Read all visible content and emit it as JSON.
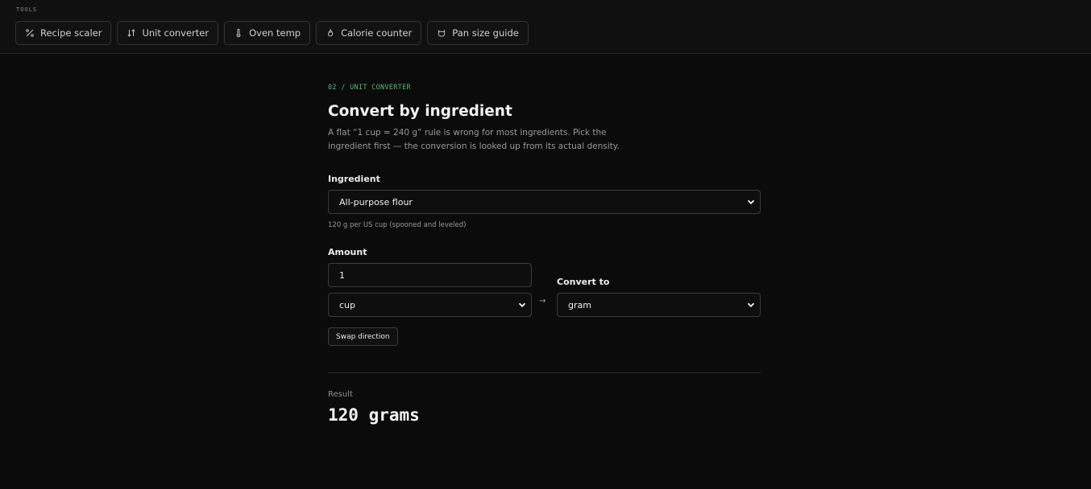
{
  "tools": {
    "label": "TOOLS",
    "items": [
      {
        "label": "Recipe scaler",
        "icon": "percent-icon"
      },
      {
        "label": "Unit converter",
        "icon": "swap-arrows-icon"
      },
      {
        "label": "Oven temp",
        "icon": "thermometer-icon"
      },
      {
        "label": "Calorie counter",
        "icon": "flame-icon"
      },
      {
        "label": "Pan size guide",
        "icon": "pan-icon"
      }
    ]
  },
  "page": {
    "crumb": "02 / UNIT CONVERTER",
    "title": "Convert by ingredient",
    "description": "A flat “1 cup = 240 g” rule is wrong for most ingredients. Pick the ingredient first — the conversion is looked up from its actual density."
  },
  "ingredient": {
    "label": "Ingredient",
    "selected": "All-purpose flour",
    "hint": "120 g per US cup (spooned and leveled)"
  },
  "amount": {
    "label": "Amount",
    "value": "1",
    "unit": "cup"
  },
  "convert": {
    "label": "Convert to",
    "arrow": "→",
    "target": "gram"
  },
  "swap": {
    "label": "Swap direction"
  },
  "result": {
    "label": "Result",
    "value": "120 grams"
  },
  "colors": {
    "background": "#0b0b0b",
    "accent": "#5fb37a",
    "border": "#3c3c3c"
  }
}
